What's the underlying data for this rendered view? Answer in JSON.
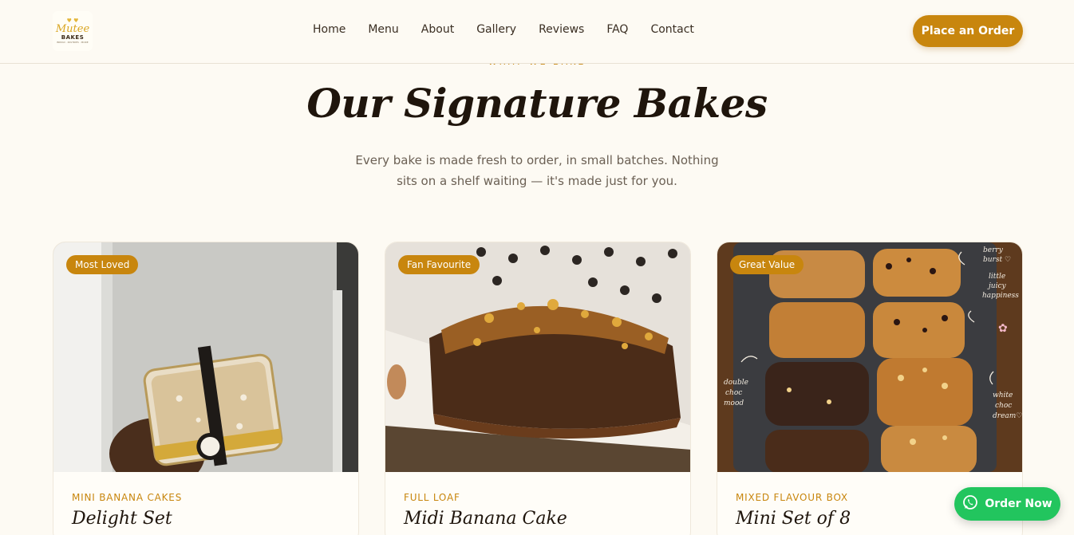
{
  "header": {
    "logo": {
      "script": "Mutee",
      "word": "BAKES",
      "tagline": "BREAD · PASTRIES · MORE"
    },
    "nav": [
      "Home",
      "Menu",
      "About",
      "Gallery",
      "Reviews",
      "FAQ",
      "Contact"
    ],
    "order_button": "Place an Order"
  },
  "section": {
    "eyebrow": "WHAT WE BAKE",
    "title": "Our Signature Bakes",
    "subtitle": "Every bake is made fresh to order, in small batches. Nothing sits on a shelf waiting — it's made just for you."
  },
  "cards": [
    {
      "badge": "Most Loved",
      "category": "MINI BANANA CAKES",
      "name": "Delight Set"
    },
    {
      "badge": "Fan Favourite",
      "category": "FULL LOAF",
      "name": "Midi Banana Cake"
    },
    {
      "badge": "Great Value",
      "category": "MIXED FLAVOUR BOX",
      "name": "Mini Set of 8"
    }
  ],
  "photo3_notes": [
    "berry burst ♡",
    "little juicy happiness",
    "double choc mood",
    "white choc dream ♡"
  ],
  "whatsapp": {
    "label": "Order Now",
    "icon": "whatsapp-icon"
  },
  "colors": {
    "accent": "#c8860e",
    "background": "#fdfaf3",
    "whatsapp": "#22c55e"
  }
}
